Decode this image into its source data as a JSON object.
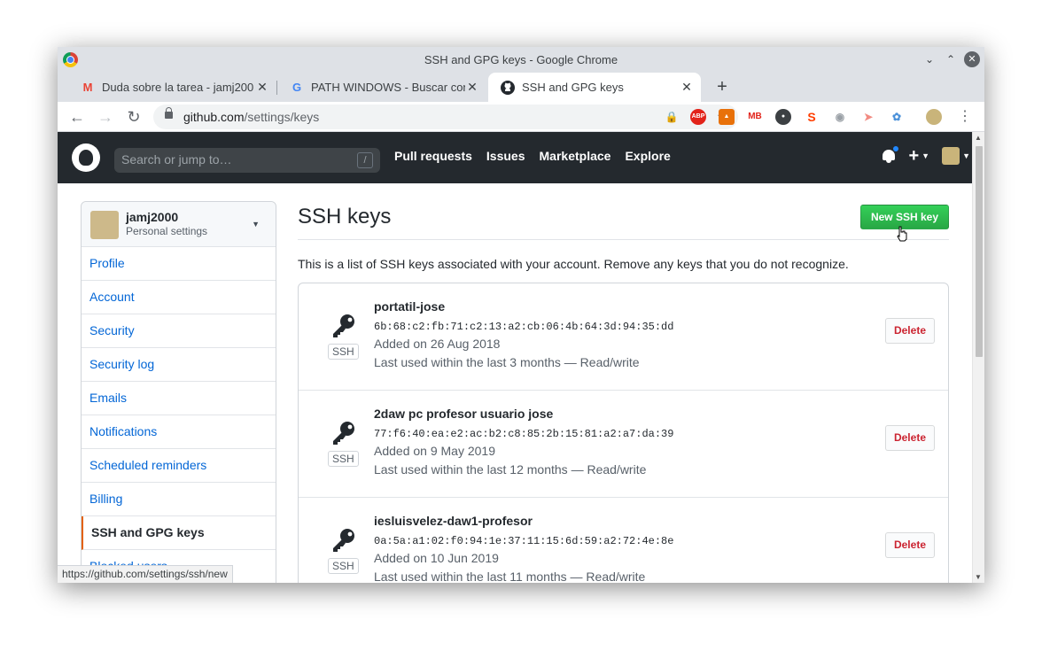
{
  "window": {
    "title": "SSH and GPG keys - Google Chrome"
  },
  "tabs": [
    {
      "title": "Duda sobre la tarea - jamj200",
      "icon": "gmail-icon"
    },
    {
      "title": "PATH WINDOWS - Buscar con",
      "icon": "google-icon"
    },
    {
      "title": "SSH and GPG keys",
      "icon": "github-icon"
    }
  ],
  "omnibox": {
    "host": "github.com",
    "path": "/settings/keys"
  },
  "gh_header": {
    "search_placeholder": "Search or jump to…",
    "search_hotkey": "/",
    "nav": [
      "Pull requests",
      "Issues",
      "Marketplace",
      "Explore"
    ],
    "plus": "+"
  },
  "sidebar": {
    "username": "jamj2000",
    "subtitle": "Personal settings",
    "items": [
      {
        "label": "Profile"
      },
      {
        "label": "Account"
      },
      {
        "label": "Security"
      },
      {
        "label": "Security log"
      },
      {
        "label": "Emails"
      },
      {
        "label": "Notifications"
      },
      {
        "label": "Scheduled reminders"
      },
      {
        "label": "Billing"
      },
      {
        "label": "SSH and GPG keys"
      },
      {
        "label": "Blocked users"
      }
    ]
  },
  "main": {
    "heading": "SSH keys",
    "new_button": "New SSH key",
    "intro": "This is a list of SSH keys associated with your account. Remove any keys that you do not recognize.",
    "badge": "SSH",
    "delete_label": "Delete",
    "keys": [
      {
        "name": "portatil-jose",
        "fingerprint": "6b:68:c2:fb:71:c2:13:a2:cb:06:4b:64:3d:94:35:dd",
        "added": "Added on 26 Aug 2018",
        "last_used": "Last used within the last 3 months — Read/write"
      },
      {
        "name": "2daw pc profesor usuario jose",
        "fingerprint": "77:f6:40:ea:e2:ac:b2:c8:85:2b:15:81:a2:a7:da:39",
        "added": "Added on 9 May 2019",
        "last_used": "Last used within the last 12 months — Read/write"
      },
      {
        "name": "iesluisvelez-daw1-profesor",
        "fingerprint": "0a:5a:a1:02:f0:94:1e:37:11:15:6d:59:a2:72:4e:8e",
        "added": "Added on 10 Jun 2019",
        "last_used": "Last used within the last 11 months — Read/write"
      }
    ]
  },
  "status_url": "https://github.com/settings/ssh/new",
  "colors": {
    "header_bg": "#24292e",
    "link": "#0366d6",
    "primary_button": "#2ea44f",
    "danger": "#cb2431",
    "selected_accent": "#e36209"
  }
}
